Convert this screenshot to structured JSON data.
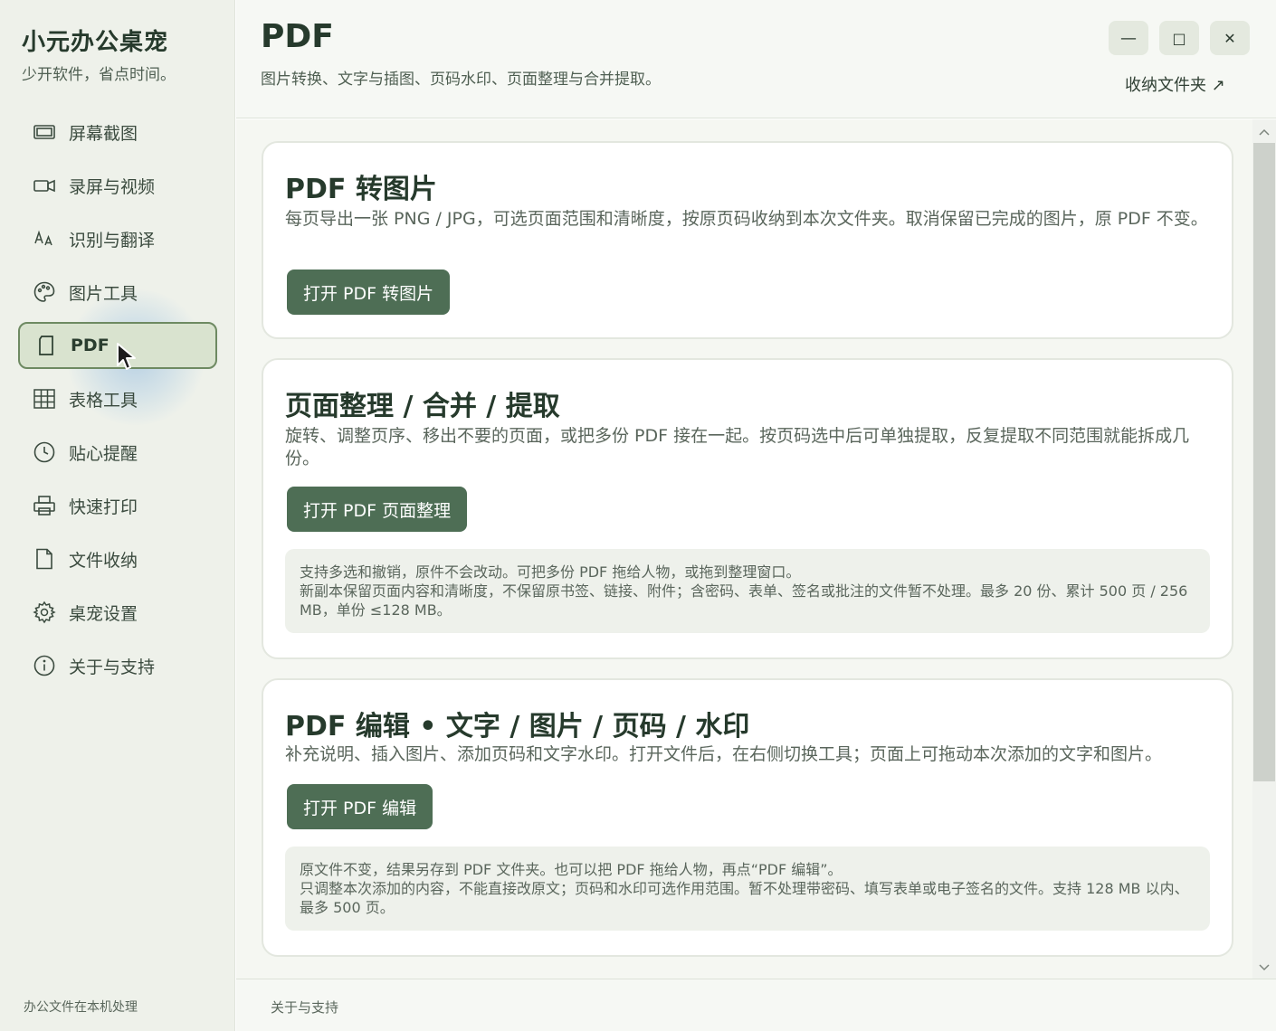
{
  "app": {
    "title": "小元办公桌宠",
    "subtitle": "少开软件，省点时间。"
  },
  "sidebar": {
    "items": [
      {
        "label": "屏幕截图",
        "icon": "screenshot-icon"
      },
      {
        "label": "录屏与视频",
        "icon": "video-camera-icon"
      },
      {
        "label": "识别与翻译",
        "icon": "translate-icon"
      },
      {
        "label": "图片工具",
        "icon": "palette-icon"
      },
      {
        "label": "PDF",
        "icon": "document-icon",
        "active": true
      },
      {
        "label": "表格工具",
        "icon": "grid-icon"
      },
      {
        "label": "贴心提醒",
        "icon": "clock-icon"
      },
      {
        "label": "快速打印",
        "icon": "printer-icon"
      },
      {
        "label": "文件收纳",
        "icon": "file-icon"
      },
      {
        "label": "桌宠设置",
        "icon": "gear-icon"
      },
      {
        "label": "关于与支持",
        "icon": "info-icon"
      }
    ],
    "footer": "办公文件在本机处理"
  },
  "header": {
    "title": "PDF",
    "description": "图片转换、文字与插图、页码水印、页面整理与合并提取。",
    "folder_link": "收纳文件夹 ↗",
    "minimize": "—",
    "maximize": "□",
    "close": "✕"
  },
  "cards": [
    {
      "title": "PDF 转图片",
      "description": "每页导出一张 PNG / JPG，可选页面范围和清晰度，按原页码收纳到本次文件夹。取消保留已完成的图片，原 PDF 不变。",
      "button": "打开 PDF 转图片"
    },
    {
      "title": "页面整理 / 合并 / 提取",
      "description": "旋转、调整页序、移出不要的页面，或把多份 PDF 接在一起。按页码选中后可单独提取，反复提取不同范围就能拆成几份。",
      "button": "打开 PDF 页面整理",
      "notes": [
        "支持多选和撤销，原件不会改动。可把多份 PDF 拖给人物，或拖到整理窗口。",
        "新副本保留页面内容和清晰度，不保留原书签、链接、附件；含密码、表单、签名或批注的文件暂不处理。最多 20 份、累计 500 页 / 256 MB，单份 ≤128 MB。"
      ]
    },
    {
      "title": "PDF 编辑 • 文字 / 图片 / 页码 / 水印",
      "description": "补充说明、插入图片、添加页码和文字水印。打开文件后，在右侧切换工具；页面上可拖动本次添加的文字和图片。",
      "button": "打开 PDF 编辑",
      "notes": [
        "原文件不变，结果另存到 PDF 文件夹。也可以把 PDF 拖给人物，再点“PDF 编辑”。",
        "只调整本次添加的内容，不能直接改原文；页码和水印可选作用范围。暂不处理带密码、填写表单或电子签名的文件。支持 128 MB 以内、最多 500 页。"
      ]
    }
  ],
  "bottom": {
    "link": "关于与支持"
  },
  "colors": {
    "accent": "#4e6e55",
    "sidebar_bg": "#eef1ea",
    "active_bg": "#d9e3cf",
    "active_border": "#6e8a62"
  }
}
